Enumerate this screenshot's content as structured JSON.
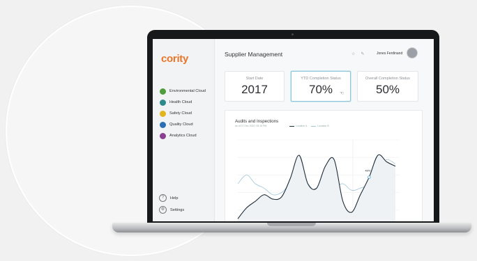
{
  "sidebar": {
    "logo": "cority",
    "items": [
      {
        "label": "Environmental Cloud",
        "color": "#4f9e3e"
      },
      {
        "label": "Health Cloud",
        "color": "#2e8a8c"
      },
      {
        "label": "Safety Cloud",
        "color": "#e3b51c"
      },
      {
        "label": "Quality Cloud",
        "color": "#2a6fb3"
      },
      {
        "label": "Analytics Cloud",
        "color": "#8b3f93"
      }
    ],
    "bottom": [
      {
        "label": "Help",
        "icon": "help-icon"
      },
      {
        "label": "Settings",
        "icon": "settings-icon"
      }
    ]
  },
  "header": {
    "title": "Supplier Management",
    "user": "Jones Ferdinand"
  },
  "cards": [
    {
      "label": "Start Date",
      "value": "2017"
    },
    {
      "label": "YTD Completion Status",
      "value": "70%"
    },
    {
      "label": "Overall Completion Status",
      "value": "50%"
    }
  ],
  "chart_data": {
    "type": "line",
    "title": "Audits and Inspections",
    "subtitle": "as of 07 Dec 2020, 09:15 PM",
    "legend": [
      "Location A",
      "Location B"
    ],
    "annotation": "48%",
    "series": [
      {
        "name": "Location A",
        "color": "#1e2d3a",
        "x": [
          0,
          1,
          2,
          3,
          4,
          5,
          6,
          7,
          8,
          9,
          10,
          11,
          12,
          13,
          14,
          15,
          16,
          17,
          18
        ],
        "values": [
          8,
          18,
          24,
          30,
          26,
          28,
          45,
          66,
          40,
          36,
          56,
          62,
          24,
          14,
          30,
          46,
          66,
          60,
          56
        ]
      },
      {
        "name": "Location B",
        "color": "#9fc6d6",
        "x": [
          0,
          1,
          2,
          3,
          4,
          5,
          6,
          7,
          8,
          9,
          10,
          11,
          12,
          13,
          14,
          15,
          16,
          17,
          18
        ],
        "values": [
          40,
          48,
          40,
          36,
          30,
          32,
          40,
          44,
          40,
          30,
          28,
          36,
          40,
          34,
          36,
          40,
          54,
          62,
          58
        ]
      }
    ],
    "ylim": [
      0,
      80
    ]
  }
}
